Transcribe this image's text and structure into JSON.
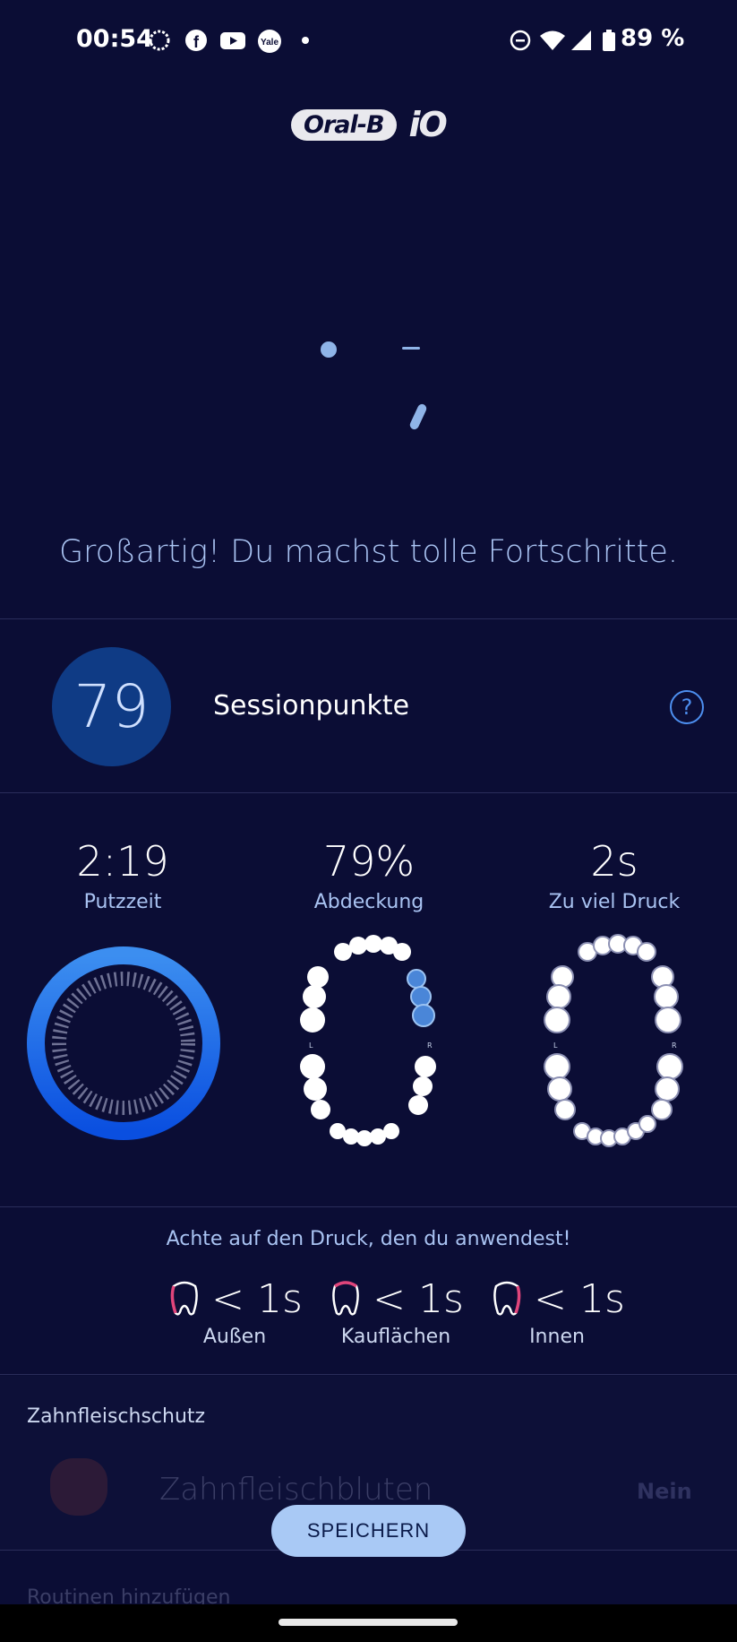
{
  "status_bar": {
    "time": "00:54",
    "battery": "89 %",
    "icons": [
      "signal-app-icon",
      "facebook-icon",
      "youtube-icon",
      "yale-icon",
      "dot-icon",
      "dnd-icon",
      "wifi-icon",
      "cell-signal-icon",
      "battery-icon"
    ]
  },
  "logo": {
    "brand": "Oral-B",
    "product": "iO"
  },
  "headline": "Großartig! Du machst tolle Fortschritte.",
  "score": {
    "value": "79",
    "label": "Sessionpunkte",
    "help": "?"
  },
  "metrics": [
    {
      "value": "2:19",
      "label": "Putzzeit"
    },
    {
      "value": "79%",
      "label": "Abdeckung"
    },
    {
      "value": "2s",
      "label": "Zu viel Druck"
    }
  ],
  "jaw_labels": {
    "left": "L",
    "right": "R"
  },
  "pressure": {
    "title": "Achte auf den Druck, den du anwendest!",
    "zones": [
      {
        "value": "< 1s",
        "label": "Außen"
      },
      {
        "value": "< 1s",
        "label": "Kauflächen"
      },
      {
        "value": "< 1s",
        "label": "Innen"
      }
    ]
  },
  "gum": {
    "title": "Zahnfleischschutz",
    "label": "Zahnfleischbluten",
    "value": "Nein"
  },
  "save_button": "SPEICHERN",
  "routines": "Routinen hinzufügen",
  "colors": {
    "background": "#0b0d35",
    "accent": "#4d8ff0",
    "highlight": "#a9c9f5",
    "pink": "#e0457b"
  }
}
